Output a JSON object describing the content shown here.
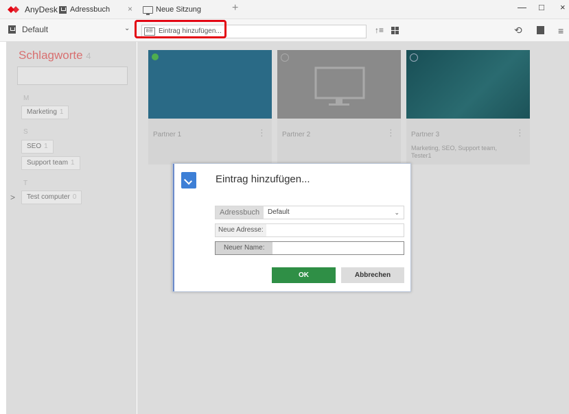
{
  "titlebar": {
    "app_name": "AnyDesk",
    "tabs": [
      {
        "label": "Adressbuch",
        "icon": "address-book-icon",
        "active": true
      },
      {
        "label": "Neue Sitzung",
        "icon": "monitor-icon",
        "active": false
      }
    ],
    "close_tab_glyph": "×",
    "new_tab_glyph": "+",
    "window_buttons": {
      "minimize": "—",
      "maximize": "□",
      "close": "×"
    }
  },
  "toolbar": {
    "addressbook_value": "Default",
    "add_entry_label": "Eintrag hinzufügen...",
    "entry_icon_text": "8☰"
  },
  "sidebar": {
    "title": "Schlagworte",
    "count": "4",
    "groups": [
      {
        "letter": "M",
        "tags": [
          {
            "label": "Marketing",
            "count": "1"
          }
        ]
      },
      {
        "letter": "S",
        "tags": [
          {
            "label": "SEO",
            "count": "1"
          },
          {
            "label": "Support team",
            "count": "1"
          }
        ]
      },
      {
        "letter": "T",
        "tags": [
          {
            "label": "Test computer",
            "count": "0"
          }
        ]
      }
    ]
  },
  "cards": [
    {
      "name": "Partner 1",
      "tags": "",
      "status": "online"
    },
    {
      "name": "Partner 2",
      "tags": "",
      "status": "offline"
    },
    {
      "name": "Partner 3",
      "tags": "Marketing, SEO, Support team, Tester1",
      "status": "offline"
    }
  ],
  "dialog": {
    "title": "Eintrag hinzufügen...",
    "addressbook_label": "Adressbuch",
    "addressbook_value": "Default",
    "new_address_label": "Neue Adresse:",
    "new_address_value": "",
    "new_name_label": "Neuer Name:",
    "new_name_value": "",
    "ok_label": "OK",
    "cancel_label": "Abbrechen"
  },
  "colors": {
    "brand_red": "#e30613",
    "ok_green": "#2f8f46",
    "card1_blue": "#1f6d8f",
    "card3_teal": "#1c5a62"
  }
}
